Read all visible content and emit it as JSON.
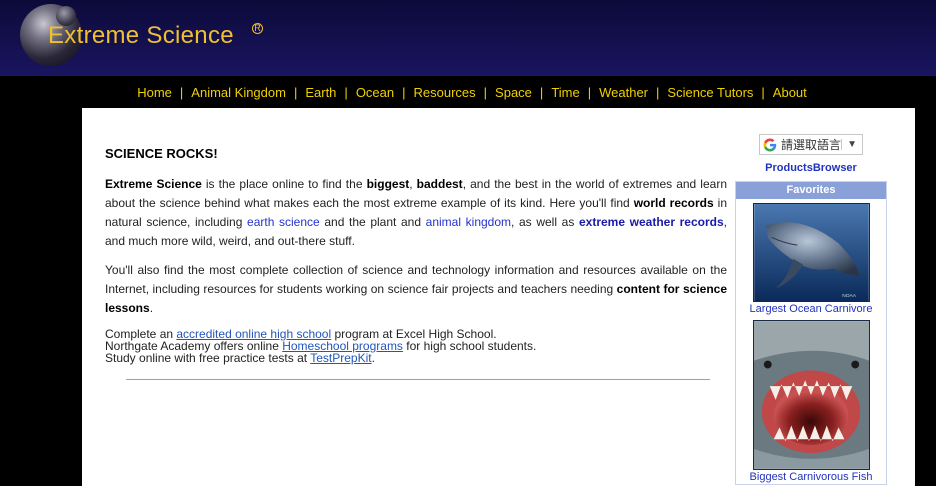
{
  "header": {
    "logo_text": "Extreme Science",
    "reg_mark": "R"
  },
  "nav": [
    "Home",
    "Animal Kingdom",
    "Earth",
    "Ocean",
    "Resources",
    "Space",
    "Time",
    "Weather",
    "Science Tutors",
    "About"
  ],
  "nav_separator": "|",
  "content": {
    "heading": "SCIENCE ROCKS!",
    "p1": {
      "a": "Extreme Science",
      "b": " is the place online to find the ",
      "c": "biggest",
      "d": ", ",
      "e": "baddest",
      "f": ", and the best in the world of extremes and learn about the science behind what makes each the most extreme example of its kind. Here you'll find ",
      "g": "world records",
      "h": " in natural science, including ",
      "i": "earth science",
      "j": " and the plant and ",
      "k": "animal kingdom",
      "l": ", as well as ",
      "m": "extreme weather records",
      "n": ", and much more wild, weird, and out-there stuff."
    },
    "p2": {
      "a": "You'll also find the most complete collection of science and technology information and resources available on the Internet, including resources for students working on science fair projects and teachers needing ",
      "b": "content for science lessons",
      "c": "."
    },
    "promo": [
      {
        "pre": "Complete an ",
        "link": "accredited online high school",
        "post": " program at Excel High School."
      },
      {
        "pre": "Northgate Academy offers online ",
        "link": "Homeschool programs",
        "post": " for high school students."
      },
      {
        "pre": "Study online with free practice tests at ",
        "link": "TestPrepKit",
        "post": "."
      }
    ]
  },
  "sidebar": {
    "translate_label": "請選取語言",
    "translate_caret": "▼",
    "products_link": "ProductsBrowser",
    "favorites_title": "Favorites",
    "favorites": [
      {
        "label": "Largest Ocean Carnivore",
        "image_credit": "NOAA"
      },
      {
        "label": "Biggest Carnivorous Fish"
      }
    ]
  },
  "colors": {
    "nav_text": "#f0d000",
    "logo_text": "#f0c030",
    "link": "#2233cc",
    "favorites_header": "#8aa0d8"
  }
}
